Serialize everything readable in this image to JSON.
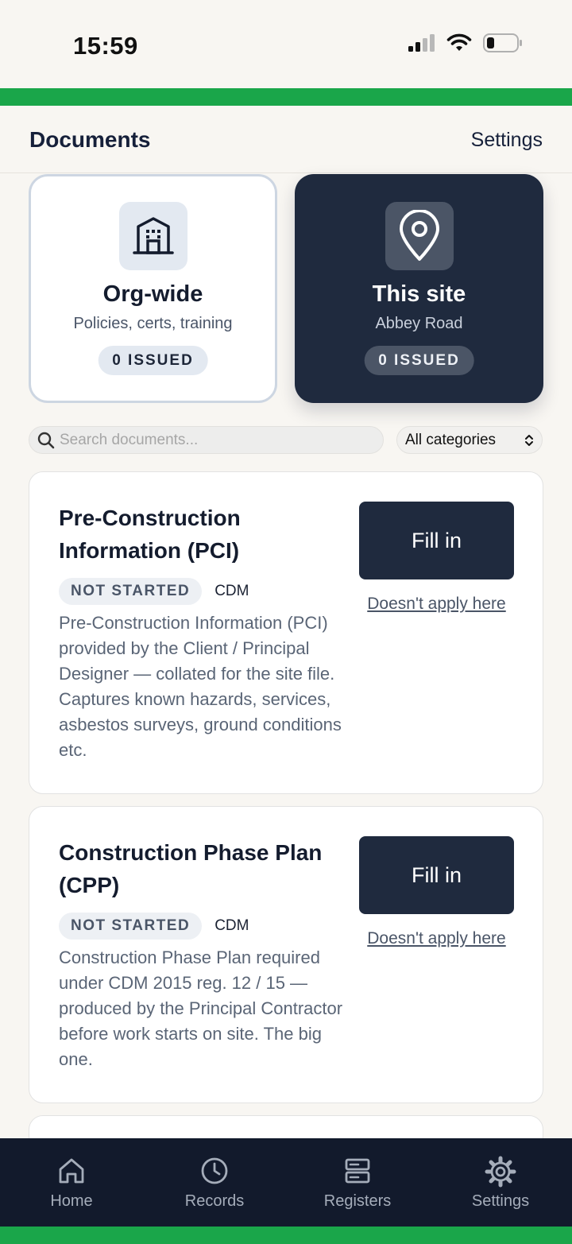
{
  "status_bar": {
    "time": "15:59"
  },
  "header": {
    "title": "Documents",
    "settings_label": "Settings"
  },
  "scope": {
    "org": {
      "title": "Org-wide",
      "subtitle": "Policies, certs, training",
      "badge": "0 ISSUED",
      "icon": "building-icon"
    },
    "site": {
      "title": "This site",
      "subtitle": "Abbey Road",
      "badge": "0 ISSUED",
      "icon": "map-pin-icon"
    }
  },
  "search": {
    "placeholder": "Search documents...",
    "value": ""
  },
  "category_filter": {
    "selected": "All categories"
  },
  "documents": [
    {
      "title": "Pre-Construction Information (PCI)",
      "status": "NOT STARTED",
      "category": "CDM",
      "description": "Pre-Construction Information (PCI) provided by the Client / Principal Designer — collated for the site file. Captures known hazards, services, asbestos surveys, ground conditions etc.",
      "action_label": "Fill in",
      "na_label": "Doesn't apply here"
    },
    {
      "title": "Construction Phase Plan (CPP)",
      "status": "NOT STARTED",
      "category": "CDM",
      "description": "Construction Phase Plan required under CDM 2015 reg. 12 / 15 — produced by the Principal Contractor before work starts on site. The big one.",
      "action_label": "Fill in",
      "na_label": "Doesn't apply here"
    }
  ],
  "tab_bar": {
    "items": [
      {
        "label": "Home",
        "icon": "home-icon"
      },
      {
        "label": "Records",
        "icon": "clock-icon"
      },
      {
        "label": "Registers",
        "icon": "server-icon"
      },
      {
        "label": "Settings",
        "icon": "gear-icon"
      }
    ]
  },
  "colors": {
    "accent_green": "#1aa64a",
    "navy": "#1f2a3e",
    "tab_bg": "#121a2c"
  }
}
